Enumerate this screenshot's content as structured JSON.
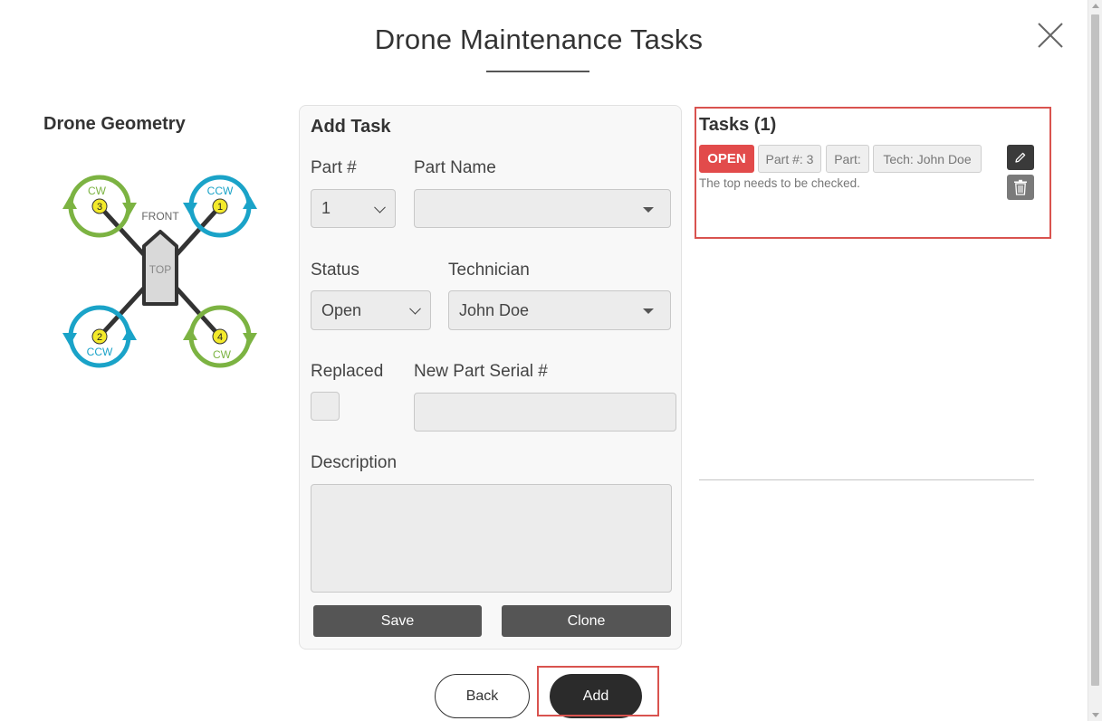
{
  "dialog": {
    "title": "Drone Maintenance Tasks"
  },
  "geometry": {
    "heading": "Drone Geometry",
    "front_label": "FRONT",
    "top_label": "TOP",
    "rotors": [
      {
        "number": "1",
        "dir": "CCW",
        "color": "#1aa3c8"
      },
      {
        "number": "2",
        "dir": "CCW",
        "color": "#1aa3c8"
      },
      {
        "number": "3",
        "dir": "CW",
        "color": "#7cb342"
      },
      {
        "number": "4",
        "dir": "CW",
        "color": "#7cb342"
      }
    ]
  },
  "form": {
    "heading": "Add Task",
    "part_no": {
      "label": "Part #",
      "value": "1"
    },
    "part_name": {
      "label": "Part Name",
      "value": ""
    },
    "status": {
      "label": "Status",
      "value": "Open"
    },
    "technician": {
      "label": "Technician",
      "value": "John Doe"
    },
    "replaced": {
      "label": "Replaced",
      "checked": false
    },
    "serial": {
      "label": "New Part Serial #",
      "value": ""
    },
    "description": {
      "label": "Description",
      "value": ""
    },
    "save_label": "Save",
    "clone_label": "Clone"
  },
  "tasks": {
    "heading": "Tasks (1)",
    "items": [
      {
        "status": "OPEN",
        "part_no": "Part #: 3",
        "part": "Part:",
        "tech": "Tech: John Doe",
        "description": "The top needs to be checked."
      }
    ]
  },
  "footer": {
    "back_label": "Back",
    "add_label": "Add"
  },
  "colors": {
    "open_badge": "#e24b4b",
    "highlight": "#d9534f",
    "cw_green": "#7cb342",
    "ccw_blue": "#1aa3c8"
  }
}
